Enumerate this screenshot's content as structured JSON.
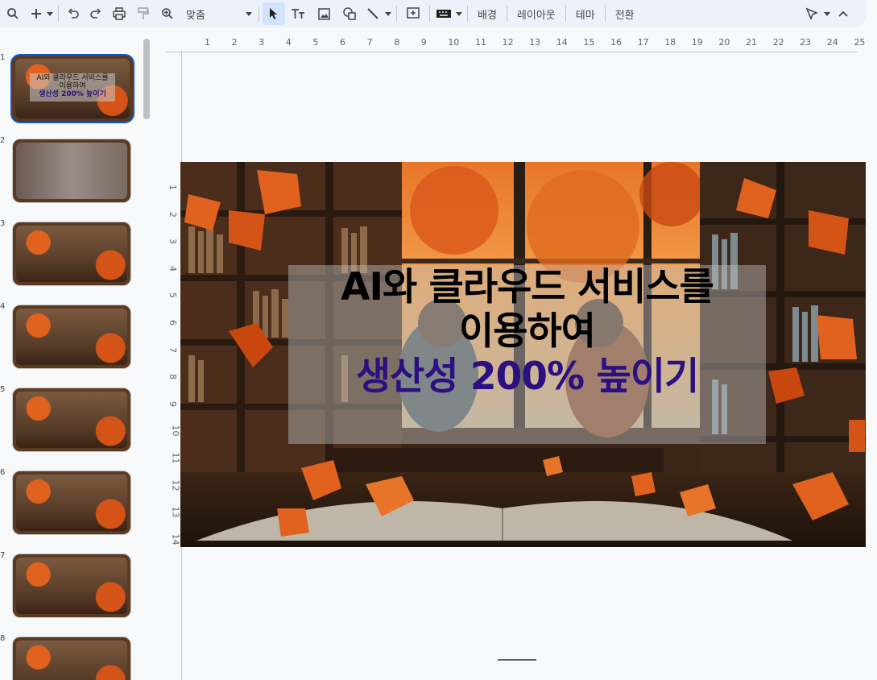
{
  "toolbar": {
    "zoom_label": "맞춤",
    "background_label": "배경",
    "layout_label": "레이아웃",
    "theme_label": "테마",
    "transition_label": "전환",
    "icons": [
      "search-icon",
      "add-icon",
      "undo-icon",
      "redo-icon",
      "print-icon",
      "paint-format-icon",
      "zoom-icon",
      "select-cursor-icon",
      "text-box-icon",
      "image-icon",
      "shapes-icon",
      "line-icon",
      "comment-icon",
      "keyboard-icon",
      "pen-icon",
      "collapse-icon"
    ]
  },
  "filmstrip": {
    "slides": [
      {
        "num": "1",
        "selected": true,
        "line1": "AI와 클라우드 서비스를",
        "line2": "이용하여",
        "line3": "생산성 200% 높이기"
      },
      {
        "num": "2",
        "selected": false,
        "line1": "",
        "line2": "",
        "line3": ""
      },
      {
        "num": "3",
        "selected": false,
        "line1": "",
        "line2": "",
        "line3": ""
      },
      {
        "num": "4",
        "selected": false,
        "line1": "",
        "line2": "",
        "line3": ""
      },
      {
        "num": "5",
        "selected": false,
        "line1": "",
        "line2": "",
        "line3": ""
      },
      {
        "num": "6",
        "selected": false,
        "line1": "",
        "line2": "",
        "line3": ""
      },
      {
        "num": "7",
        "selected": false,
        "line1": "",
        "line2": "",
        "line3": ""
      },
      {
        "num": "8",
        "selected": false,
        "line1": "",
        "line2": "",
        "line3": ""
      }
    ]
  },
  "ruler": {
    "top_marks": [
      "1",
      "2",
      "3",
      "4",
      "5",
      "6",
      "7",
      "8",
      "9",
      "10",
      "11",
      "12",
      "13",
      "14",
      "15",
      "16",
      "17",
      "18",
      "19",
      "20",
      "21",
      "22",
      "23",
      "24",
      "25"
    ],
    "left_marks": [
      "1",
      "2",
      "3",
      "4",
      "5",
      "6",
      "7",
      "8",
      "9",
      "10",
      "11",
      "12",
      "13",
      "14"
    ]
  },
  "slide": {
    "title_line1": "AI와 클라우드 서비스를",
    "title_line2": "이용하여",
    "title_line3": "생산성 200% 높이기",
    "accent_color": "#2a1080",
    "leaf_color": "#e0621e"
  }
}
